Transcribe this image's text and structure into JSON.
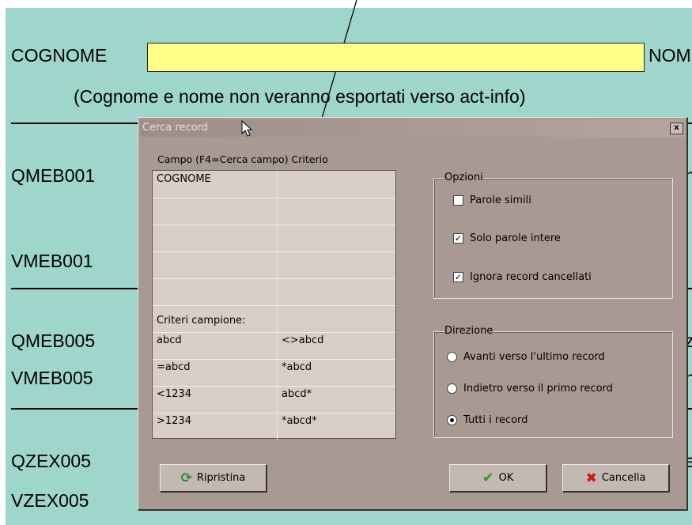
{
  "form": {
    "cognome_label": "COGNOME",
    "nome_label": "NOM",
    "note": "(Cognome e nome non veranno esportati verso act-info)",
    "fields": [
      "QMEB001",
      "VMEB001",
      "QMEB005",
      "VMEB005",
      "QZEX005",
      "VZEX005"
    ],
    "right_fragments": [
      "n'",
      "z",
      "h",
      "e"
    ]
  },
  "dialog": {
    "title": "Cerca record",
    "close_label": "x",
    "grid_header": "Campo  (F4=Cerca campo)  Criterio",
    "rows": [
      [
        "COGNOME",
        ""
      ],
      [
        "",
        ""
      ],
      [
        "",
        ""
      ],
      [
        "",
        ""
      ],
      [
        "",
        ""
      ],
      [
        "Criteri campione:",
        ""
      ],
      [
        "abcd",
        "<>abcd"
      ],
      [
        "=abcd",
        "*abcd"
      ],
      [
        "<1234",
        "abcd*"
      ],
      [
        ">1234",
        "*abcd*"
      ]
    ],
    "options": {
      "title": "Opzioni",
      "items": [
        {
          "label": "Parole simili",
          "checked": false
        },
        {
          "label": "Solo parole intere",
          "checked": true
        },
        {
          "label": "Ignora record cancellati",
          "checked": true
        }
      ]
    },
    "direction": {
      "title": "Direzione",
      "items": [
        {
          "label": "Avanti verso l'ultimo record",
          "selected": false
        },
        {
          "label": "Indietro verso il primo record",
          "selected": false
        },
        {
          "label": "Tutti i record",
          "selected": true
        }
      ]
    },
    "buttons": {
      "reset": "Ripristina",
      "ok": "OK",
      "cancel": "Cancella"
    }
  },
  "colors": {
    "form_bg": "#9fd6cc",
    "field_bg": "#ffff88",
    "dialog_bg": "#a89a93",
    "ok_icon": "#2e9b2e",
    "cancel_icon": "#d01818",
    "reset_icon": "#1f8f3a"
  }
}
